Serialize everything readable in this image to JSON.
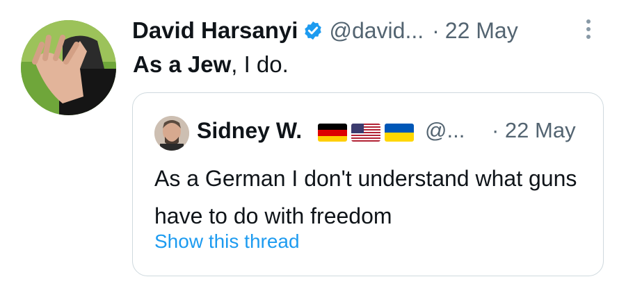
{
  "tweet": {
    "author_name": "David Harsanyi",
    "handle": "@david...",
    "dot": "·",
    "date": "22 May",
    "text_bold": "As a Jew",
    "text_rest": ", I do."
  },
  "quote": {
    "author_name": "Sidney W.",
    "flags": [
      "germany-flag",
      "usa-flag",
      "ukraine-flag"
    ],
    "handle": "@...",
    "date": "· 22 May",
    "text": "As a German I don't understand what guns have to do with freedom",
    "link": "Show this thread"
  },
  "colors": {
    "link": "#1d9bf0",
    "secondary_text": "#536471",
    "verified": "#1d9bf0",
    "border": "#cfd9de"
  }
}
